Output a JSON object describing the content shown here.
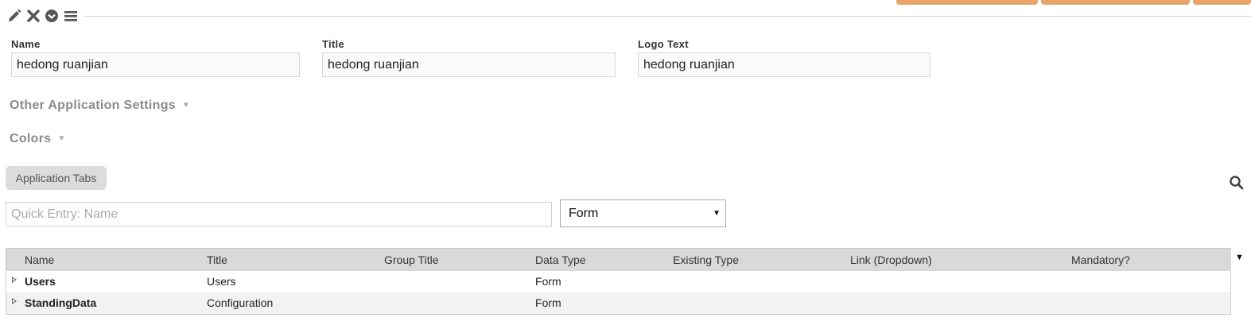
{
  "toolbar": {
    "icons": [
      "pencil-icon",
      "close-icon",
      "chevron-circle-down-icon",
      "menu-icon"
    ]
  },
  "fields": {
    "name": {
      "label": "Name",
      "value": "hedong ruanjian"
    },
    "title": {
      "label": "Title",
      "value": "hedong ruanjian"
    },
    "logo_text": {
      "label": "Logo Text",
      "value": "hedong ruanjian"
    }
  },
  "sections": {
    "other_settings": "Other Application Settings",
    "colors": "Colors",
    "caret": "▼"
  },
  "tabs": {
    "application_tabs": "Application Tabs"
  },
  "quick_entry": {
    "placeholder": "Quick Entry: Name",
    "value": ""
  },
  "type_select": {
    "selected": "Form",
    "arrow": "▼"
  },
  "grid": {
    "columns": [
      "Name",
      "Title",
      "Group Title",
      "Data Type",
      "Existing Type",
      "Link (Dropdown)",
      "Mandatory?"
    ],
    "rows": [
      {
        "name": "Users",
        "title": "Users",
        "group_title": "",
        "data_type": "Form",
        "existing_type": "",
        "link": "",
        "mandatory": ""
      },
      {
        "name": "StandingData",
        "title": "Configuration",
        "group_title": "",
        "data_type": "Form",
        "existing_type": "",
        "link": "",
        "mandatory": ""
      }
    ],
    "menu_arrow": "▼"
  },
  "colors": {
    "accent_orange": "#e8a56a",
    "header_bg": "#d9d9d9",
    "alt_row_bg": "#f2f2f2"
  }
}
